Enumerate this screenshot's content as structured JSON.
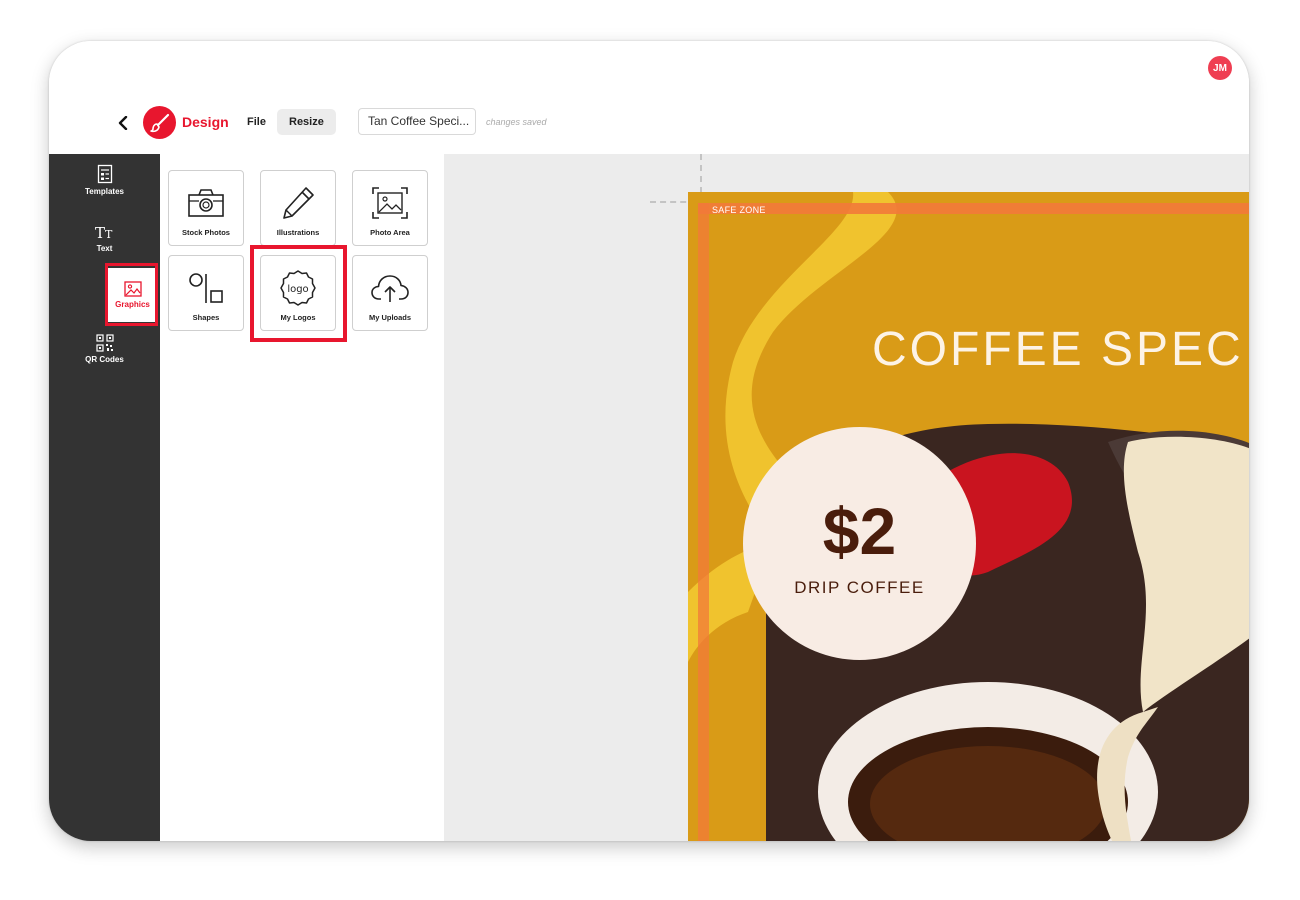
{
  "header": {
    "avatar_initials": "JM",
    "brand": "Design",
    "menu": {
      "file": "File",
      "resize": "Resize"
    },
    "doc_title": "Tan Coffee Speci...",
    "save_status": "changes saved"
  },
  "rail": {
    "items": [
      {
        "label": "Templates",
        "icon": "templates-icon"
      },
      {
        "label": "Text",
        "icon": "text-icon"
      },
      {
        "label": "Graphics",
        "icon": "image-icon"
      },
      {
        "label": "QR Codes",
        "icon": "qr-code-icon"
      }
    ],
    "active": "Graphics"
  },
  "panel": {
    "tiles": [
      {
        "label": "Stock Photos",
        "icon": "camera-icon"
      },
      {
        "label": "Illustrations",
        "icon": "pencil-icon"
      },
      {
        "label": "Photo Area",
        "icon": "photo-frame-icon"
      },
      {
        "label": "Shapes",
        "icon": "shapes-icon"
      },
      {
        "label": "My Logos",
        "icon": "logo-badge-icon",
        "logo_text": "logo"
      },
      {
        "label": "My Uploads",
        "icon": "cloud-upload-icon"
      }
    ],
    "highlighted": "My Logos"
  },
  "canvas": {
    "safe_zone_label": "SAFE ZONE",
    "title": "COFFEE SPEC",
    "price": "$2",
    "price_subtitle": "DRIP COFFEE"
  },
  "colors": {
    "accent": "#e8162e",
    "avatar": "#ef3e52",
    "rail_bg": "#333333",
    "poster_bg": "#d99b17",
    "safe_zone": "#f27a3a",
    "price_text": "#4a1d0c"
  }
}
